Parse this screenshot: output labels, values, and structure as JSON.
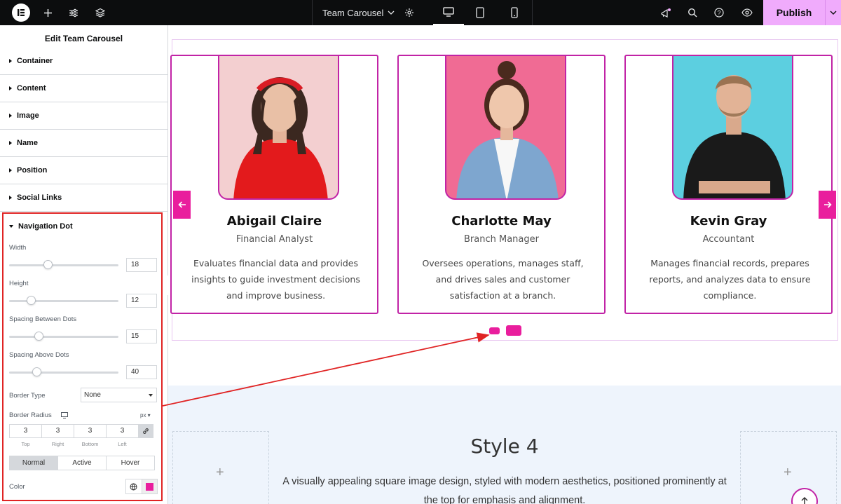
{
  "topbar": {
    "document_title": "Team Carousel",
    "publish_label": "Publish"
  },
  "panel": {
    "title": "Edit Team Carousel",
    "sections": [
      {
        "label": "Container"
      },
      {
        "label": "Content"
      },
      {
        "label": "Image"
      },
      {
        "label": "Name"
      },
      {
        "label": "Position"
      },
      {
        "label": "Social Links"
      }
    ],
    "navigation_dot": {
      "label": "Navigation Dot",
      "width": {
        "label": "Width",
        "value": "18",
        "level": 0.35
      },
      "height": {
        "label": "Height",
        "value": "12",
        "level": 0.2
      },
      "spacing_between": {
        "label": "Spacing Between Dots",
        "value": "15",
        "level": 0.27
      },
      "spacing_above": {
        "label": "Spacing Above Dots",
        "value": "40",
        "level": 0.25
      },
      "border_type": {
        "label": "Border Type",
        "value": "None"
      },
      "border_radius": {
        "label": "Border Radius",
        "unit": "px",
        "values": [
          "3",
          "3",
          "3",
          "3"
        ],
        "labels": [
          "Top",
          "Right",
          "Bottom",
          "Left"
        ]
      },
      "states": [
        "Normal",
        "Active",
        "Hover"
      ],
      "active_state": "Normal",
      "color": {
        "label": "Color",
        "swatch": "#e91e9d"
      }
    }
  },
  "carousel": {
    "cards": [
      {
        "name": "Abigail Claire",
        "position": "Financial Analyst",
        "description": "Evaluates financial data and provides insights to guide investment decisions and improve business.",
        "bg": "#f3cfd0"
      },
      {
        "name": "Charlotte May",
        "position": "Branch Manager",
        "description": "Oversees operations, manages staff, and drives sales and customer satisfaction at a branch.",
        "bg": "#f06b94"
      },
      {
        "name": "Kevin Gray",
        "position": "Accountant",
        "description": "Manages financial records, prepares reports, and analyzes data to ensure compliance.",
        "bg": "#5ccfe0"
      }
    ],
    "accent": "#e91e9d"
  },
  "style4": {
    "title": "Style 4",
    "description": "A visually appealing square image design, styled with modern aesthetics, positioned prominently at the top for emphasis and alignment."
  },
  "colors": {
    "topbar_bg": "#0c0d0e",
    "publish_bg": "#f0abfc",
    "card_border": "#c123a6",
    "callout": "#e02424"
  }
}
